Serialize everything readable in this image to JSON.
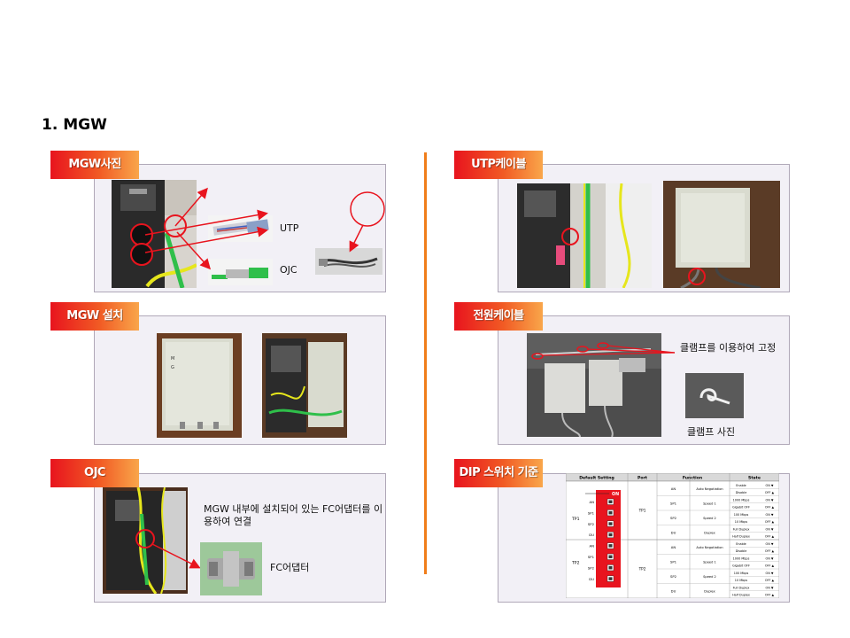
{
  "page": {
    "title": "1. MGW"
  },
  "sections": {
    "mgw_photo": {
      "label": "MGW사진",
      "utp": "UTP",
      "ojc": "OJC"
    },
    "mgw_install": {
      "label": "MGW 설치"
    },
    "ojc": {
      "label": "OJC",
      "desc": "MGW 내부에 설치되어 있는 FC어댑터를 이용하여 연결",
      "adapter": "FC어댑터"
    },
    "utp_cable": {
      "label": "UTP케이블"
    },
    "power_cable": {
      "label": "전원케이블",
      "desc": "클램프를 이용하여 고정",
      "clamp": "클램프 사진"
    },
    "dip_switch": {
      "label": "DIP 스위치 기준",
      "headers": [
        "Default Setting",
        "Port",
        "Function",
        "State"
      ],
      "switch_on": "ON",
      "switch_labels": [
        "AN",
        "SP1",
        "SP2",
        "DU",
        "AN",
        "SP1",
        "SP2",
        "DU"
      ],
      "group_labels": [
        "TP1",
        "TP2"
      ],
      "ports": [
        "TP1",
        "TP2"
      ],
      "groups": [
        {
          "port": "TP1",
          "rows": [
            {
              "sw": "AN",
              "func": "Auto Negotiation",
              "states": [
                "Enable",
                "ON ▼",
                "Disable",
                "OFF ▲"
              ]
            },
            {
              "sw": "SP1",
              "func": "Speed 1",
              "states": [
                "1000 Mbps",
                "ON ▼",
                "Gigabit OFF",
                "OFF ▲"
              ]
            },
            {
              "sw": "SP2",
              "func": "Speed 2",
              "states": [
                "100 Mbps",
                "ON ▼",
                "10 Mbps",
                "OFF ▲"
              ]
            },
            {
              "sw": "DU",
              "func": "Duplex",
              "states": [
                "Full Duplex",
                "ON ▼",
                "Half Duplex",
                "OFF ▲"
              ]
            }
          ]
        },
        {
          "port": "TP2",
          "rows": [
            {
              "sw": "AN",
              "func": "Auto Negotiation",
              "states": [
                "Enable",
                "ON ▼",
                "Disable",
                "OFF ▲"
              ]
            },
            {
              "sw": "SP1",
              "func": "Speed 1",
              "states": [
                "1000 Mbps",
                "ON ▼",
                "Gigabit OFF",
                "OFF ▲"
              ]
            },
            {
              "sw": "SP2",
              "func": "Speed 2",
              "states": [
                "100 Mbps",
                "ON ▼",
                "10 Mbps",
                "OFF ▲"
              ]
            },
            {
              "sw": "DU",
              "func": "Duplex",
              "states": [
                "Full Duplex",
                "ON ▼",
                "Half Duplex",
                "OFF ▲"
              ]
            }
          ]
        }
      ]
    }
  },
  "colors": {
    "accent": "#f07d1a",
    "annotation": "#e8141e",
    "panel_bg": "#f2f0f6"
  }
}
